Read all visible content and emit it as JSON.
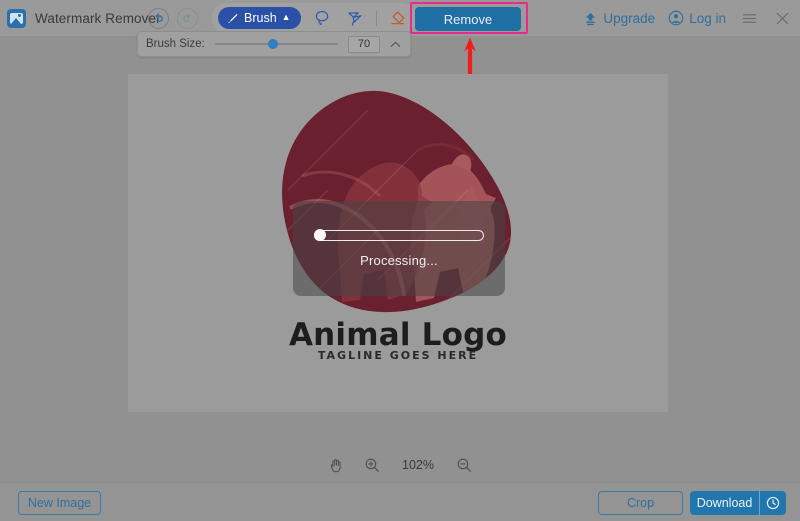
{
  "app": {
    "title": "Watermark Remover",
    "icon": "app-logo-icon"
  },
  "toolbar": {
    "undo_icon": "undo-arrow-icon",
    "redo_icon": "redo-arrow-icon",
    "brush_label": "Brush",
    "brush_chevron": "chevron-up-icon",
    "lasso_icon": "lasso-tool-icon",
    "polygon_icon": "polygon-lasso-icon",
    "eraser_icon": "eraser-tool-icon",
    "remove_label": "Remove",
    "highlight_color": "#e82a8c",
    "remove_button_color": "#1f6ea4"
  },
  "brush_size_panel": {
    "label": "Brush Size:",
    "value": "70",
    "slider_percent": 47,
    "collapse_icon": "chevron-up-icon"
  },
  "account": {
    "upgrade_label": "Upgrade",
    "upgrade_icon": "upload-upgrade-icon",
    "login_label": "Log in",
    "login_icon": "user-circle-icon",
    "menu_icon": "hamburger-menu-icon",
    "close_icon": "close-x-icon"
  },
  "annotation": {
    "arrow_color": "#f01d1d",
    "arrow_icon": "red-up-arrow-annotation"
  },
  "canvas": {
    "background": "#9b9b9b",
    "logo": {
      "title": "Animal Logo",
      "tagline": "TAGLINE GOES HERE",
      "art_dark_color": "#6b2030",
      "art_mid_color": "#8c3640",
      "art_light_color": "#a9595c"
    },
    "processing": {
      "text": "Processing...",
      "progress_percent": 2
    }
  },
  "zoom_bar": {
    "hand_icon": "hand-pan-icon",
    "zoom_in_icon": "zoom-in-icon",
    "level": "102%",
    "zoom_out_icon": "zoom-out-icon"
  },
  "footer": {
    "new_image_label": "New Image",
    "crop_label": "Crop",
    "download_label": "Download",
    "download_history_icon": "clock-history-icon"
  }
}
